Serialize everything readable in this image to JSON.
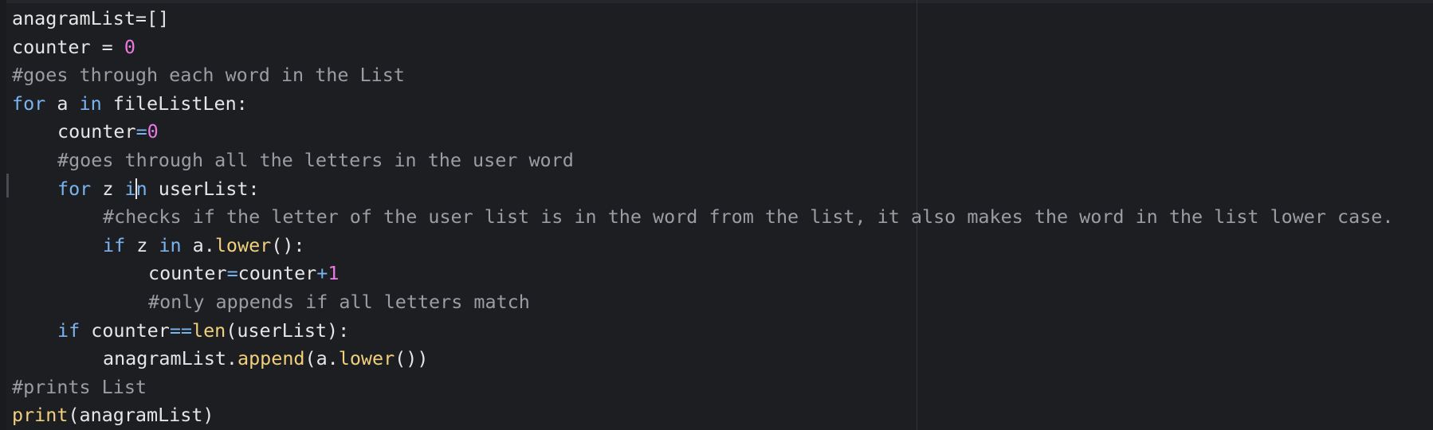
{
  "editor": {
    "lines": [
      {
        "indent": 0,
        "tokens": [
          {
            "t": "anagramList=[]",
            "c": ""
          }
        ]
      },
      {
        "indent": 0,
        "tokens": [
          {
            "t": "counter = ",
            "c": ""
          },
          {
            "t": "0",
            "c": "num"
          }
        ]
      },
      {
        "indent": 0,
        "tokens": [
          {
            "t": "#goes through each word in the List",
            "c": "cm"
          }
        ]
      },
      {
        "indent": 0,
        "tokens": [
          {
            "t": "for",
            "c": "kw"
          },
          {
            "t": " a ",
            "c": ""
          },
          {
            "t": "in",
            "c": "kw"
          },
          {
            "t": " fileListLen:",
            "c": ""
          }
        ]
      },
      {
        "indent": 1,
        "tokens": [
          {
            "t": "counter",
            "c": ""
          },
          {
            "t": "=",
            "c": "op"
          },
          {
            "t": "0",
            "c": "num"
          }
        ]
      },
      {
        "indent": 1,
        "tokens": [
          {
            "t": "#goes through all the letters in the user word",
            "c": "cm"
          }
        ]
      },
      {
        "indent": 1,
        "tokens": [
          {
            "t": "for",
            "c": "kw"
          },
          {
            "t": " z ",
            "c": ""
          },
          {
            "t": "i",
            "c": "kw"
          },
          {
            "t": "|caret|",
            "c": "caret"
          },
          {
            "t": "n",
            "c": "kw"
          },
          {
            "t": " userList:",
            "c": ""
          }
        ]
      },
      {
        "indent": 2,
        "tokens": [
          {
            "t": "#checks if the letter of the user list is in the word from the list, it also makes the word in the list lower case.",
            "c": "cm"
          }
        ]
      },
      {
        "indent": 2,
        "tokens": [
          {
            "t": "if",
            "c": "kw"
          },
          {
            "t": " z ",
            "c": ""
          },
          {
            "t": "in",
            "c": "kw"
          },
          {
            "t": " a.",
            "c": ""
          },
          {
            "t": "lower",
            "c": "fn"
          },
          {
            "t": "():",
            "c": ""
          }
        ]
      },
      {
        "indent": 3,
        "tokens": [
          {
            "t": "counter",
            "c": ""
          },
          {
            "t": "=",
            "c": "op"
          },
          {
            "t": "counter",
            "c": ""
          },
          {
            "t": "+",
            "c": "op"
          },
          {
            "t": "1",
            "c": "num"
          }
        ]
      },
      {
        "indent": 3,
        "tokens": [
          {
            "t": "#only appends if all letters match",
            "c": "cm"
          }
        ]
      },
      {
        "indent": 1,
        "tokens": [
          {
            "t": "if",
            "c": "kw"
          },
          {
            "t": " counter",
            "c": ""
          },
          {
            "t": "==",
            "c": "op"
          },
          {
            "t": "len",
            "c": "fn"
          },
          {
            "t": "(userList):",
            "c": ""
          }
        ]
      },
      {
        "indent": 2,
        "tokens": [
          {
            "t": "anagramList.",
            "c": ""
          },
          {
            "t": "append",
            "c": "fn"
          },
          {
            "t": "(a.",
            "c": ""
          },
          {
            "t": "lower",
            "c": "fn"
          },
          {
            "t": "())",
            "c": ""
          }
        ]
      },
      {
        "indent": 0,
        "tokens": [
          {
            "t": "#prints List",
            "c": "cm"
          }
        ]
      },
      {
        "indent": 0,
        "tokens": [
          {
            "t": "print",
            "c": "fn"
          },
          {
            "t": "(anagramList)",
            "c": ""
          }
        ]
      }
    ]
  },
  "colors": {
    "background": "#1d1e22",
    "text": "#e6e6e6",
    "keyword": "#7ab4f0",
    "number": "#e879e0",
    "comment": "#9a9da3",
    "function": "#f1d07d"
  }
}
